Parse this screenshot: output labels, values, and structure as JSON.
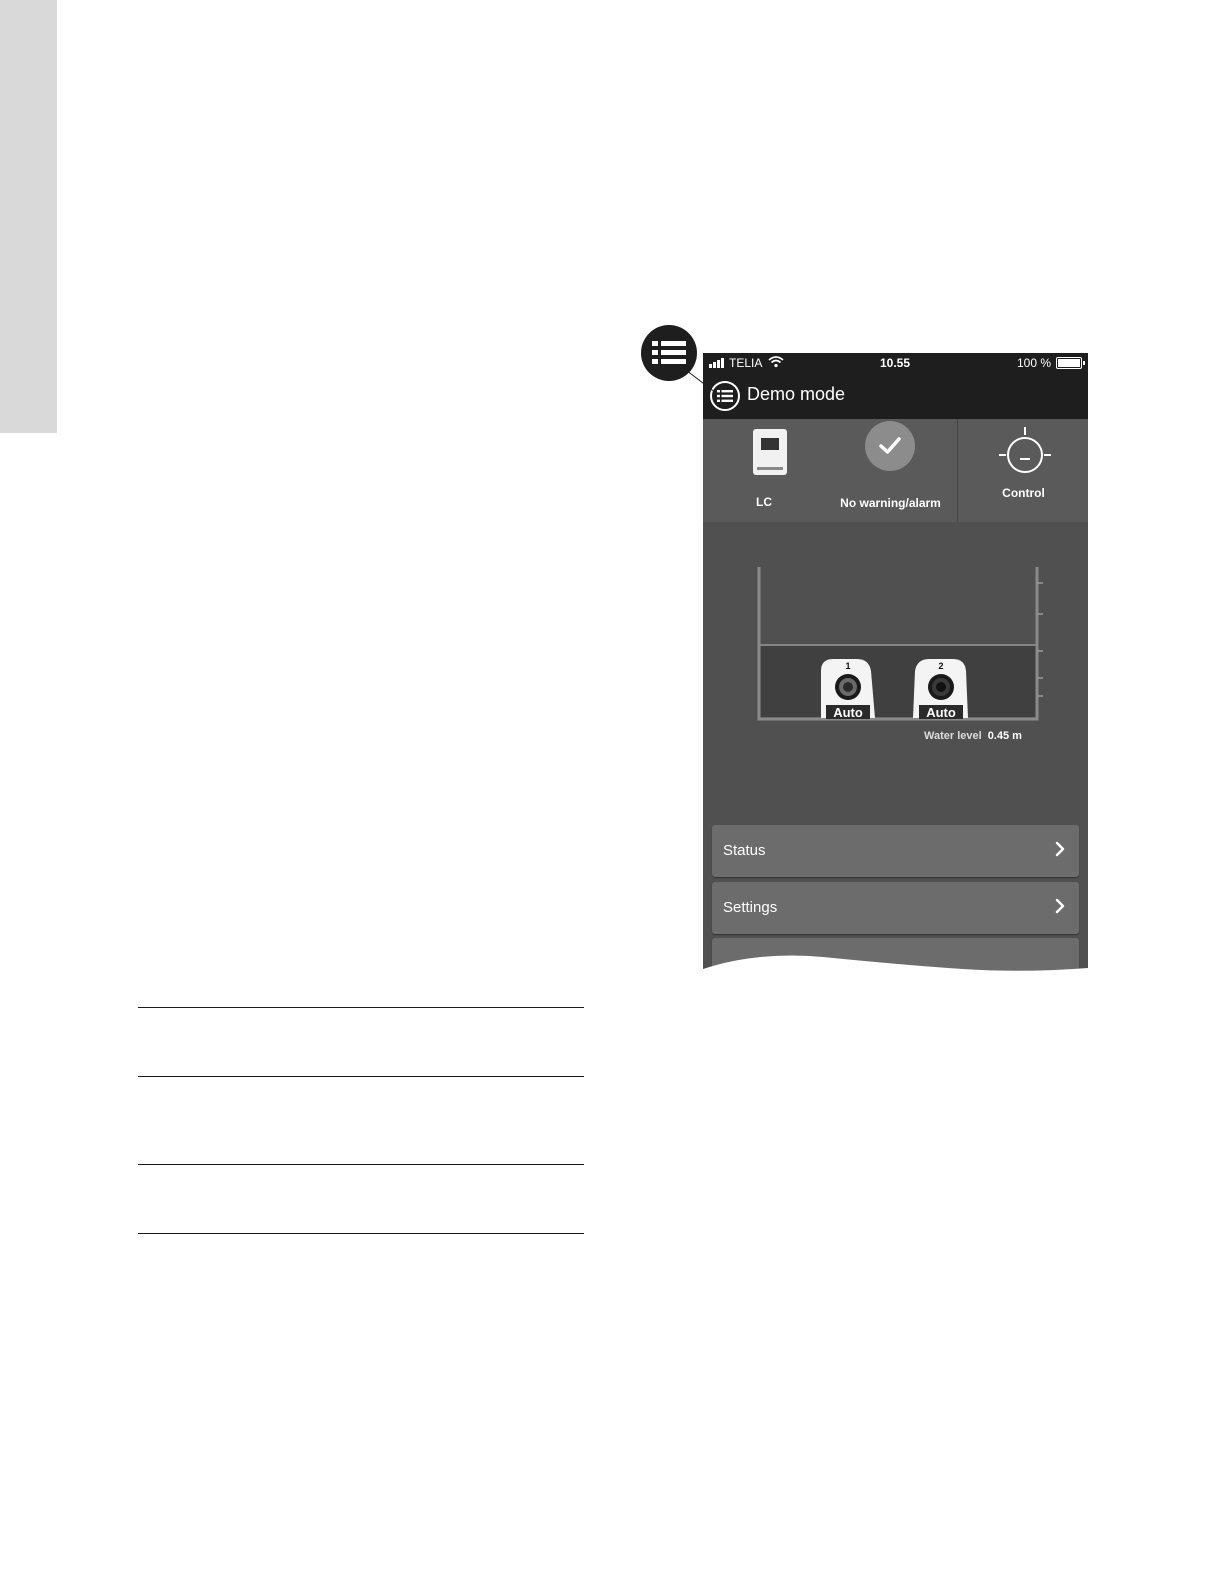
{
  "statusbar": {
    "carrier": "TELIA",
    "time": "10.55",
    "battery": "100 %"
  },
  "navbar": {
    "title": "Demo mode"
  },
  "tiles": {
    "lc": "LC",
    "alarm": "No warning/alarm",
    "control": "Control"
  },
  "tank": {
    "pump1_number": "1",
    "pump2_number": "2",
    "pump1_mode": "Auto",
    "pump2_mode": "Auto",
    "water_level_label": "Water level",
    "water_level_value": "0.45 m"
  },
  "menu": {
    "items": [
      {
        "label": "Status"
      },
      {
        "label": "Settings"
      }
    ]
  }
}
